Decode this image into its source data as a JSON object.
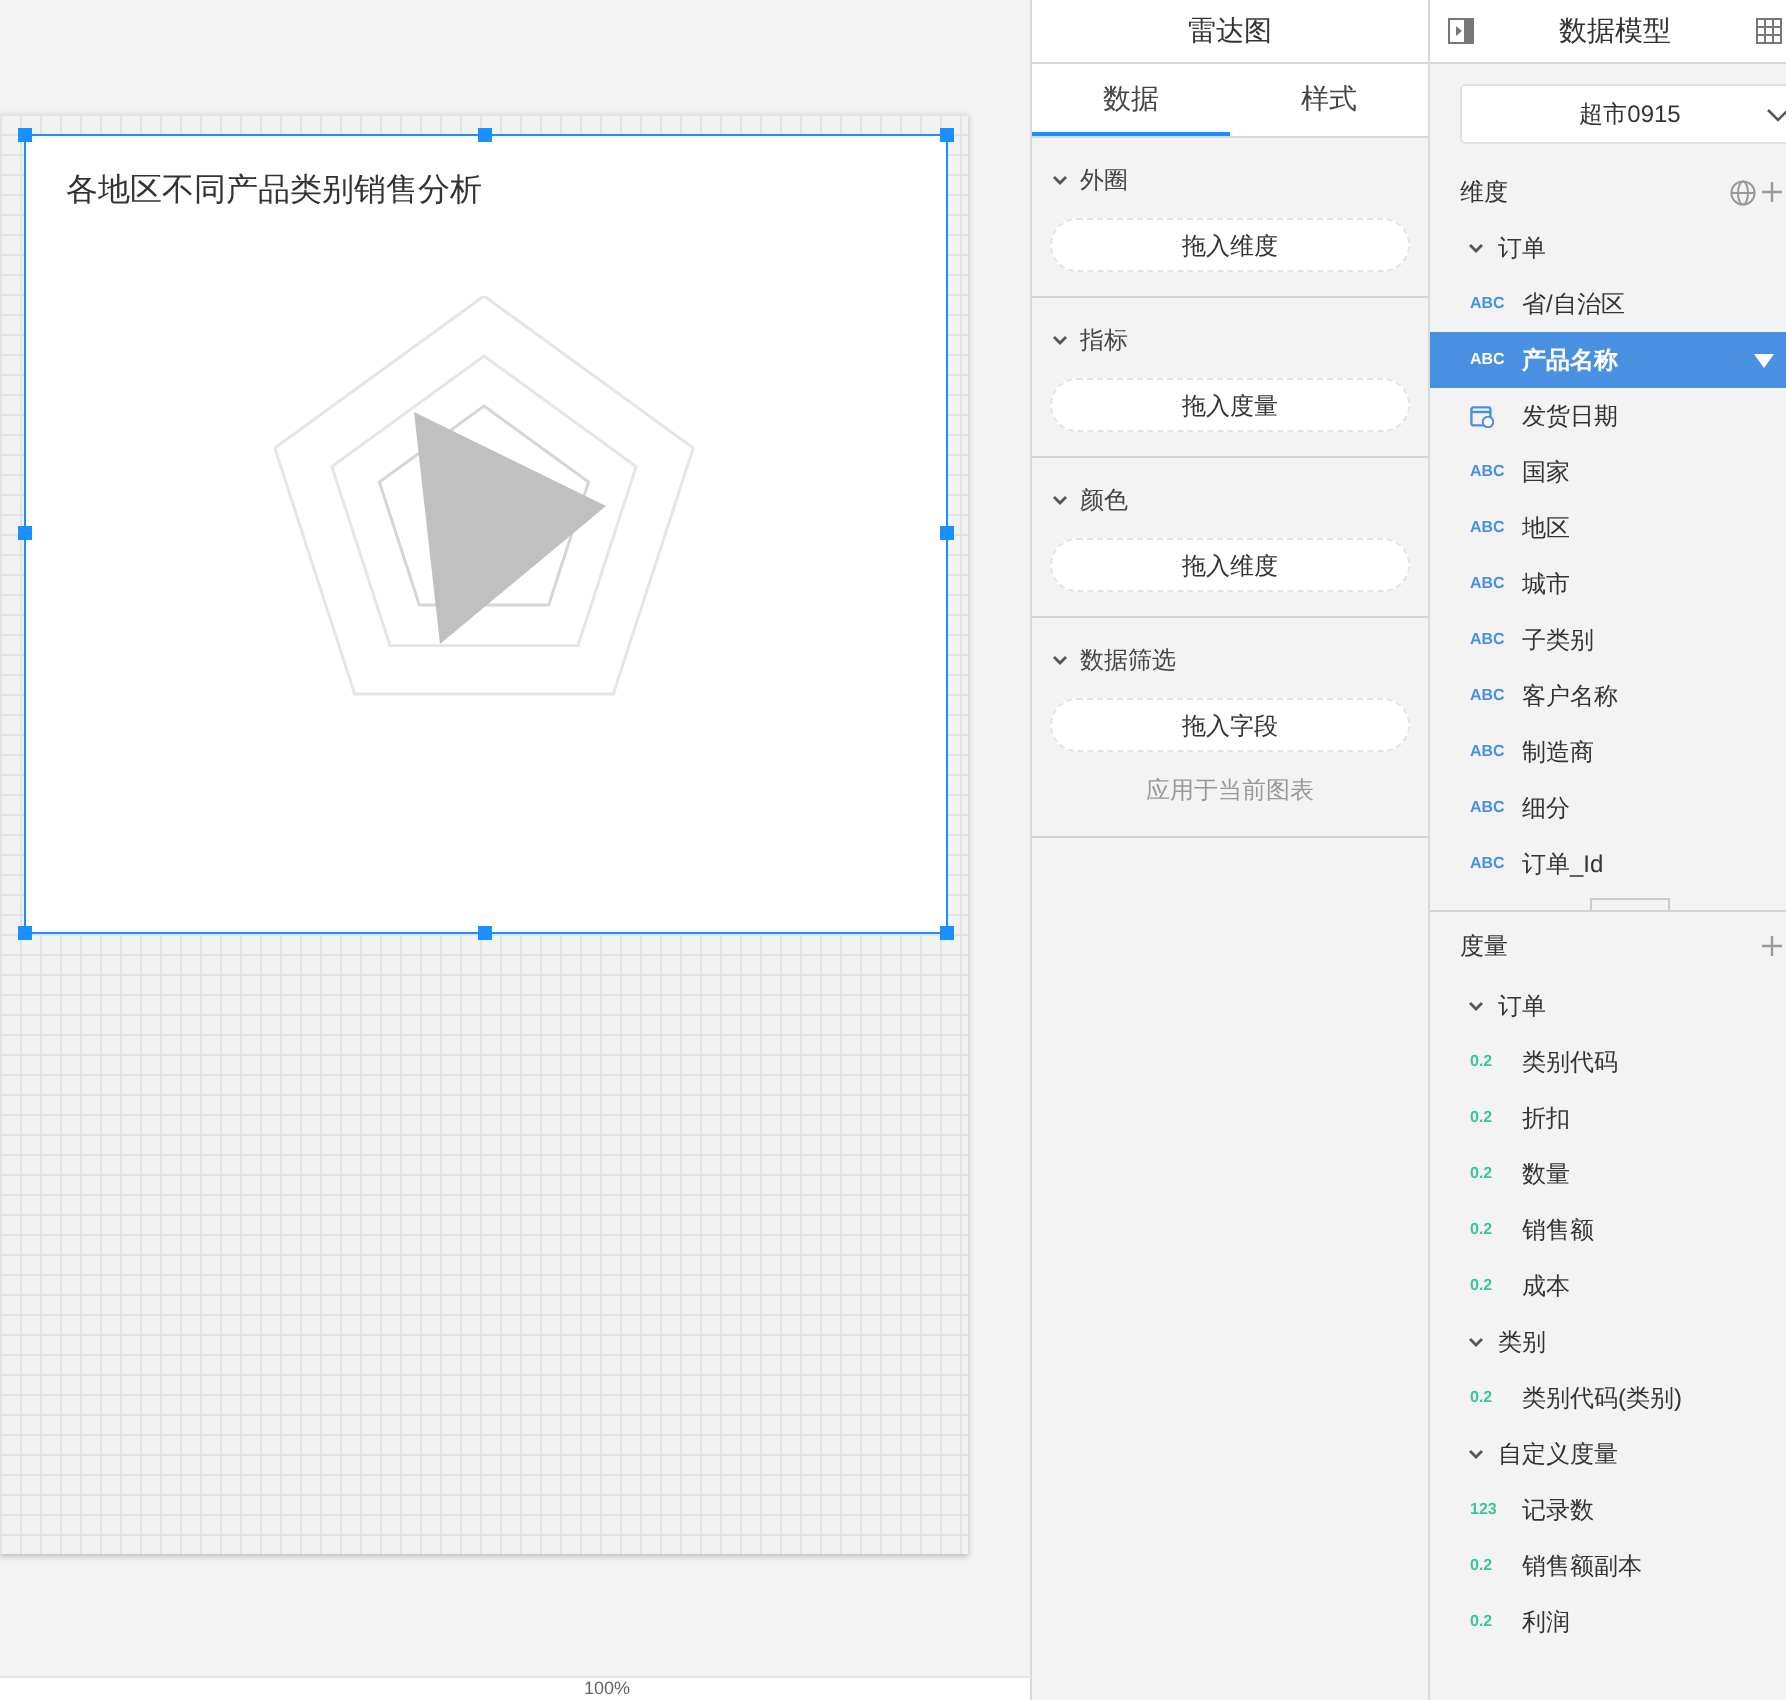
{
  "canvas": {
    "chart": {
      "title": "各地区不同产品类别销售分析",
      "selected": true
    },
    "zoom": "100%"
  },
  "chart_panel": {
    "title": "雷达图",
    "tabs": [
      {
        "label": "数据",
        "selected": true
      },
      {
        "label": "样式",
        "selected": false
      }
    ],
    "sections": [
      {
        "title": "外圈",
        "expanded": true,
        "drop_zone": "拖入维度"
      },
      {
        "title": "指标",
        "expanded": true,
        "drop_zone": "拖入度量"
      },
      {
        "title": "颜色",
        "expanded": true,
        "drop_zone": "拖入维度"
      },
      {
        "title": "数据筛选",
        "expanded": true,
        "drop_zone": "拖入字段",
        "note": "应用于当前图表"
      }
    ]
  },
  "data_model": {
    "title": "数据模型",
    "dataset": "超市0915",
    "dimensions": {
      "title": "维度",
      "groups": [
        {
          "name": "订单",
          "expanded": true,
          "fields": [
            {
              "kind": "text",
              "badge": "ABC",
              "name": "省/自治区",
              "selected": false
            },
            {
              "kind": "text",
              "badge": "ABC",
              "name": "产品名称",
              "selected": true
            },
            {
              "kind": "date",
              "name": "发货日期",
              "selected": false
            },
            {
              "kind": "text",
              "badge": "ABC",
              "name": "国家",
              "selected": false
            },
            {
              "kind": "text",
              "badge": "ABC",
              "name": "地区",
              "selected": false
            },
            {
              "kind": "text",
              "badge": "ABC",
              "name": "城市",
              "selected": false
            },
            {
              "kind": "text",
              "badge": "ABC",
              "name": "子类别",
              "selected": false
            },
            {
              "kind": "text",
              "badge": "ABC",
              "name": "客户名称",
              "selected": false
            },
            {
              "kind": "text",
              "badge": "ABC",
              "name": "制造商",
              "selected": false
            },
            {
              "kind": "text",
              "badge": "ABC",
              "name": "细分",
              "selected": false
            },
            {
              "kind": "text",
              "badge": "ABC",
              "name": "订单_Id",
              "selected": false
            }
          ]
        }
      ]
    },
    "measures": {
      "title": "度量",
      "groups": [
        {
          "name": "订单",
          "expanded": true,
          "fields": [
            {
              "kind": "number",
              "badge": "0.2",
              "name": "类别代码",
              "selected": false
            },
            {
              "kind": "number",
              "badge": "0.2",
              "name": "折扣",
              "selected": false
            },
            {
              "kind": "number",
              "badge": "0.2",
              "name": "数量",
              "selected": false
            },
            {
              "kind": "number",
              "badge": "0.2",
              "name": "销售额",
              "selected": false
            },
            {
              "kind": "number",
              "badge": "0.2",
              "name": "成本",
              "selected": false
            }
          ]
        },
        {
          "name": "类别",
          "expanded": true,
          "fields": [
            {
              "kind": "number",
              "badge": "0.2",
              "name": "类别代码(类别)",
              "selected": false
            }
          ]
        },
        {
          "name": "自定义度量",
          "expanded": true,
          "fields": [
            {
              "kind": "number",
              "badge": "123",
              "name": "记录数",
              "selected": false
            },
            {
              "kind": "number",
              "badge": "0.2",
              "name": "销售额副本",
              "selected": false
            },
            {
              "kind": "number",
              "badge": "0.2",
              "name": "利润",
              "selected": false
            }
          ]
        }
      ]
    }
  }
}
